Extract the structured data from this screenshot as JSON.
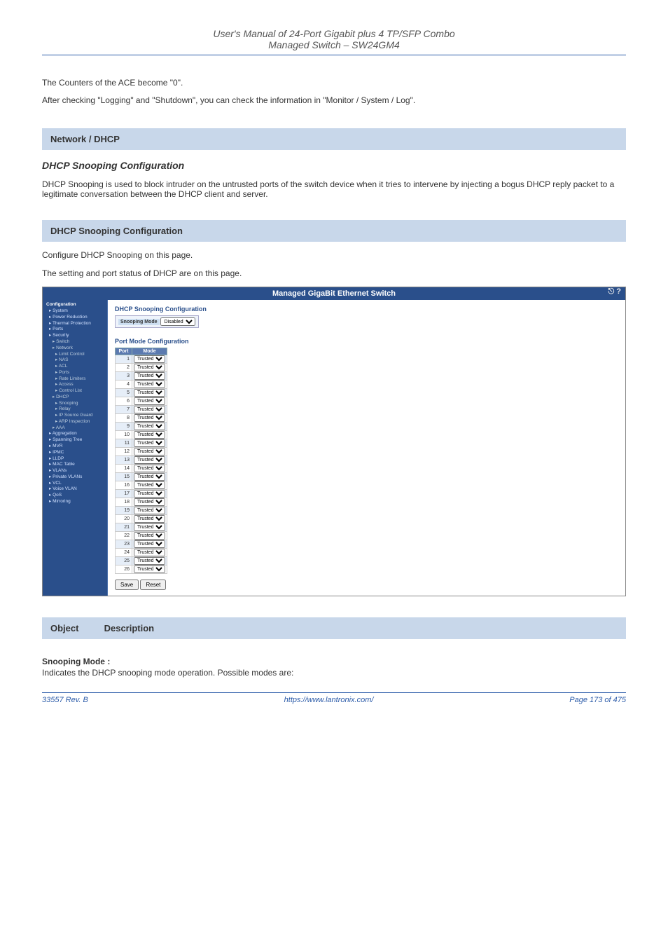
{
  "header": {
    "subtitle": "User's Manual of 24-Port Gigabit plus 4 TP/SFP Combo\nManaged Switch – SW24GM4"
  },
  "intro1": "The Counters of the ACE become \"0\".",
  "intro2": "After checking \"Logging\" and \"Shutdown\", you can check the information in \"Monitor / System / Log\".",
  "sec_dhcp_title": "Network / DHCP",
  "dhcp_cfg_title": "DHCP Snooping Configuration",
  "dhcp_para1": "DHCP Snooping is used to block intruder on the untrusted ports of the switch device when it tries to intervene by injecting a bogus DHCP reply packet to a legitimate conversation between the DHCP client and server.",
  "dhcp_para2": "Configure DHCP Snooping on this page.",
  "dhcp_para3": "The setting and port status of DHCP are on this page.",
  "screenshot": {
    "title": "Managed GigaBit Ethernet Switch",
    "sidebar": {
      "top": "Configuration",
      "items": [
        {
          "label": "System",
          "cls": "l1"
        },
        {
          "label": "Power Reduction",
          "cls": "l1"
        },
        {
          "label": "Thermal Protection",
          "cls": "l1"
        },
        {
          "label": "Ports",
          "cls": "l1"
        },
        {
          "label": "Security",
          "cls": "l1"
        },
        {
          "label": "Switch",
          "cls": "l2"
        },
        {
          "label": "Network",
          "cls": "l2"
        },
        {
          "label": "Limit Control",
          "cls": "l3"
        },
        {
          "label": "NAS",
          "cls": "l3"
        },
        {
          "label": "ACL",
          "cls": "l3"
        },
        {
          "label": "Ports",
          "cls": "l3"
        },
        {
          "label": "Rate Limiters",
          "cls": "l3"
        },
        {
          "label": "Access",
          "cls": "l3"
        },
        {
          "label": "Control List",
          "cls": "l3"
        },
        {
          "label": "DHCP",
          "cls": "l2"
        },
        {
          "label": "Snooping",
          "cls": "l3"
        },
        {
          "label": "Relay",
          "cls": "l3"
        },
        {
          "label": "IP Source Guard",
          "cls": "l3"
        },
        {
          "label": "ARP Inspection",
          "cls": "l3"
        },
        {
          "label": "AAA",
          "cls": "l2"
        },
        {
          "label": "Aggregation",
          "cls": "l1"
        },
        {
          "label": "Spanning Tree",
          "cls": "l1"
        },
        {
          "label": "MVR",
          "cls": "l1"
        },
        {
          "label": "IPMC",
          "cls": "l1"
        },
        {
          "label": "LLDP",
          "cls": "l1"
        },
        {
          "label": "MAC Table",
          "cls": "l1"
        },
        {
          "label": "VLANs",
          "cls": "l1"
        },
        {
          "label": "Private VLANs",
          "cls": "l1"
        },
        {
          "label": "VCL",
          "cls": "l1"
        },
        {
          "label": "Voice VLAN",
          "cls": "l1"
        },
        {
          "label": "QoS",
          "cls": "l1"
        },
        {
          "label": "Mirroring",
          "cls": "l1"
        }
      ]
    },
    "content": {
      "heading": "DHCP Snooping Configuration",
      "snooping_label": "Snooping Mode",
      "snooping_value": "Disabled",
      "port_mode_title": "Port Mode Configuration",
      "col_port": "Port",
      "col_mode": "Mode",
      "mode_option": "Trusted",
      "btn_save": "Save",
      "btn_reset": "Reset"
    }
  },
  "obj1_label": "Object",
  "obj1_desc": "Description",
  "snoop_mode_label": "Snooping Mode :",
  "snoop_mode_desc": "Indicates the DHCP snooping mode operation. Possible modes are:",
  "footer": {
    "left": "33557 Rev. B",
    "right": "https://www.lantronix.com/",
    "page": "Page 173 of 475"
  }
}
